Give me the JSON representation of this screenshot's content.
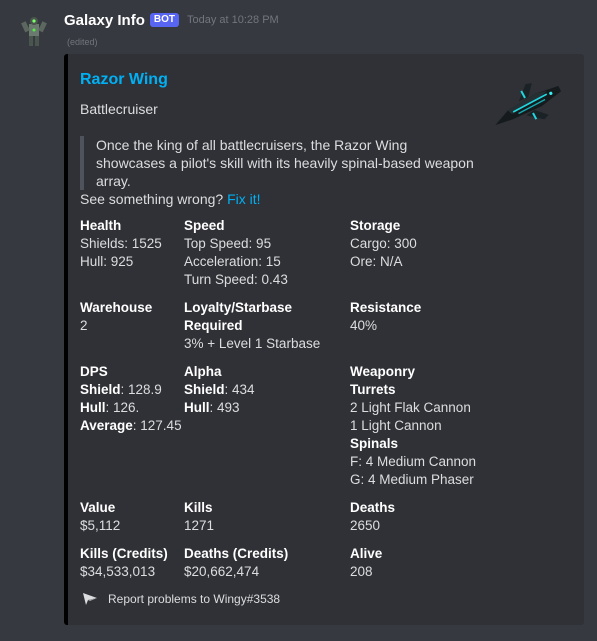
{
  "message": {
    "author": "Galaxy Info",
    "bot_tag": "BOT",
    "timestamp": "Today at 10:28 PM",
    "edited": "(edited)"
  },
  "embed": {
    "accent_color": "#000000",
    "title": "Razor Wing",
    "subtitle": "Battlecruiser",
    "description": "Once the king of all battlecruisers, the Razor Wing showcases a pilot's skill with its heavily spinal-based weapon array.",
    "fix_prompt": "See something wrong?",
    "fix_link": "Fix it!",
    "fields": {
      "health": {
        "name": "Health",
        "lines": [
          "Shields: 1525",
          "Hull: 925"
        ]
      },
      "speed": {
        "name": "Speed",
        "lines": [
          "Top Speed: 95",
          "Acceleration: 15",
          "Turn Speed: 0.43"
        ]
      },
      "storage": {
        "name": "Storage",
        "lines": [
          "Cargo: 300",
          "Ore: N/A"
        ]
      },
      "warehouse": {
        "name": "Warehouse",
        "value": "2"
      },
      "loyalty": {
        "name_1": "Loyalty/Starbase",
        "name_2": "Required",
        "value": "3% + Level 1 Starbase"
      },
      "resistance": {
        "name": "Resistance",
        "value": "40%"
      },
      "dps": {
        "name": "DPS",
        "shield_label": "Shield",
        "shield_value": ": 128.9",
        "hull_label": "Hull",
        "hull_value": ": 126.",
        "avg_label": "Average",
        "avg_value": ": 127.45"
      },
      "alpha": {
        "name": "Alpha",
        "shield_label": "Shield",
        "shield_value": ": 434",
        "hull_label": "Hull",
        "hull_value": ": 493"
      },
      "weaponry": {
        "name": "Weaponry",
        "turrets_label": "Turrets",
        "turrets": [
          "2 Light Flak Cannon",
          "1 Light Cannon"
        ],
        "spinals_label": "Spinals",
        "spinals": [
          "F: 4 Medium Cannon",
          "G: 4 Medium Phaser"
        ]
      },
      "value": {
        "name": "Value",
        "value": "$5,112"
      },
      "kills": {
        "name": "Kills",
        "value": "1271"
      },
      "deaths": {
        "name": "Deaths",
        "value": "2650"
      },
      "kills_credits": {
        "name": "Kills (Credits)",
        "value": "$34,533,013"
      },
      "deaths_credits": {
        "name": "Deaths (Credits)",
        "value": "$20,662,474"
      },
      "alive": {
        "name": "Alive",
        "value": "208"
      }
    },
    "footer": "Report problems to Wingy#3538"
  }
}
